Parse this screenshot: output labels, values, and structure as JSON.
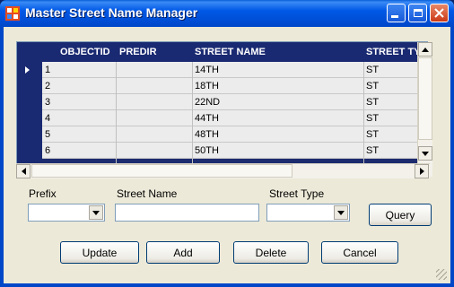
{
  "window": {
    "title": "Master Street Name Manager"
  },
  "grid": {
    "columns": [
      "OBJECTID",
      "PREDIR",
      "STREET NAME",
      "STREET TYPE"
    ],
    "rows": [
      {
        "objectid": "1",
        "predir": "",
        "street_name": "14TH",
        "street_type": "ST"
      },
      {
        "objectid": "2",
        "predir": "",
        "street_name": "18TH",
        "street_type": "ST"
      },
      {
        "objectid": "3",
        "predir": "",
        "street_name": "22ND",
        "street_type": "ST"
      },
      {
        "objectid": "4",
        "predir": "",
        "street_name": "44TH",
        "street_type": "ST"
      },
      {
        "objectid": "5",
        "predir": "",
        "street_name": "48TH",
        "street_type": "ST"
      },
      {
        "objectid": "6",
        "predir": "",
        "street_name": "50TH",
        "street_type": "ST"
      }
    ]
  },
  "form": {
    "prefix_label": "Prefix",
    "prefix_value": "",
    "street_name_label": "Street Name",
    "street_name_value": "",
    "street_type_label": "Street Type",
    "street_type_value": "",
    "query_label": "Query"
  },
  "actions": {
    "update_label": "Update",
    "add_label": "Add",
    "delete_label": "Delete",
    "cancel_label": "Cancel"
  },
  "colors": {
    "titlebar": "#0054e3",
    "grid_header": "#1a2a72",
    "face": "#ece9d8"
  },
  "icons": [
    "app-grid-icon",
    "minimize-icon",
    "maximize-icon",
    "close-icon",
    "row-pointer-icon",
    "dropdown-arrow-icon"
  ]
}
